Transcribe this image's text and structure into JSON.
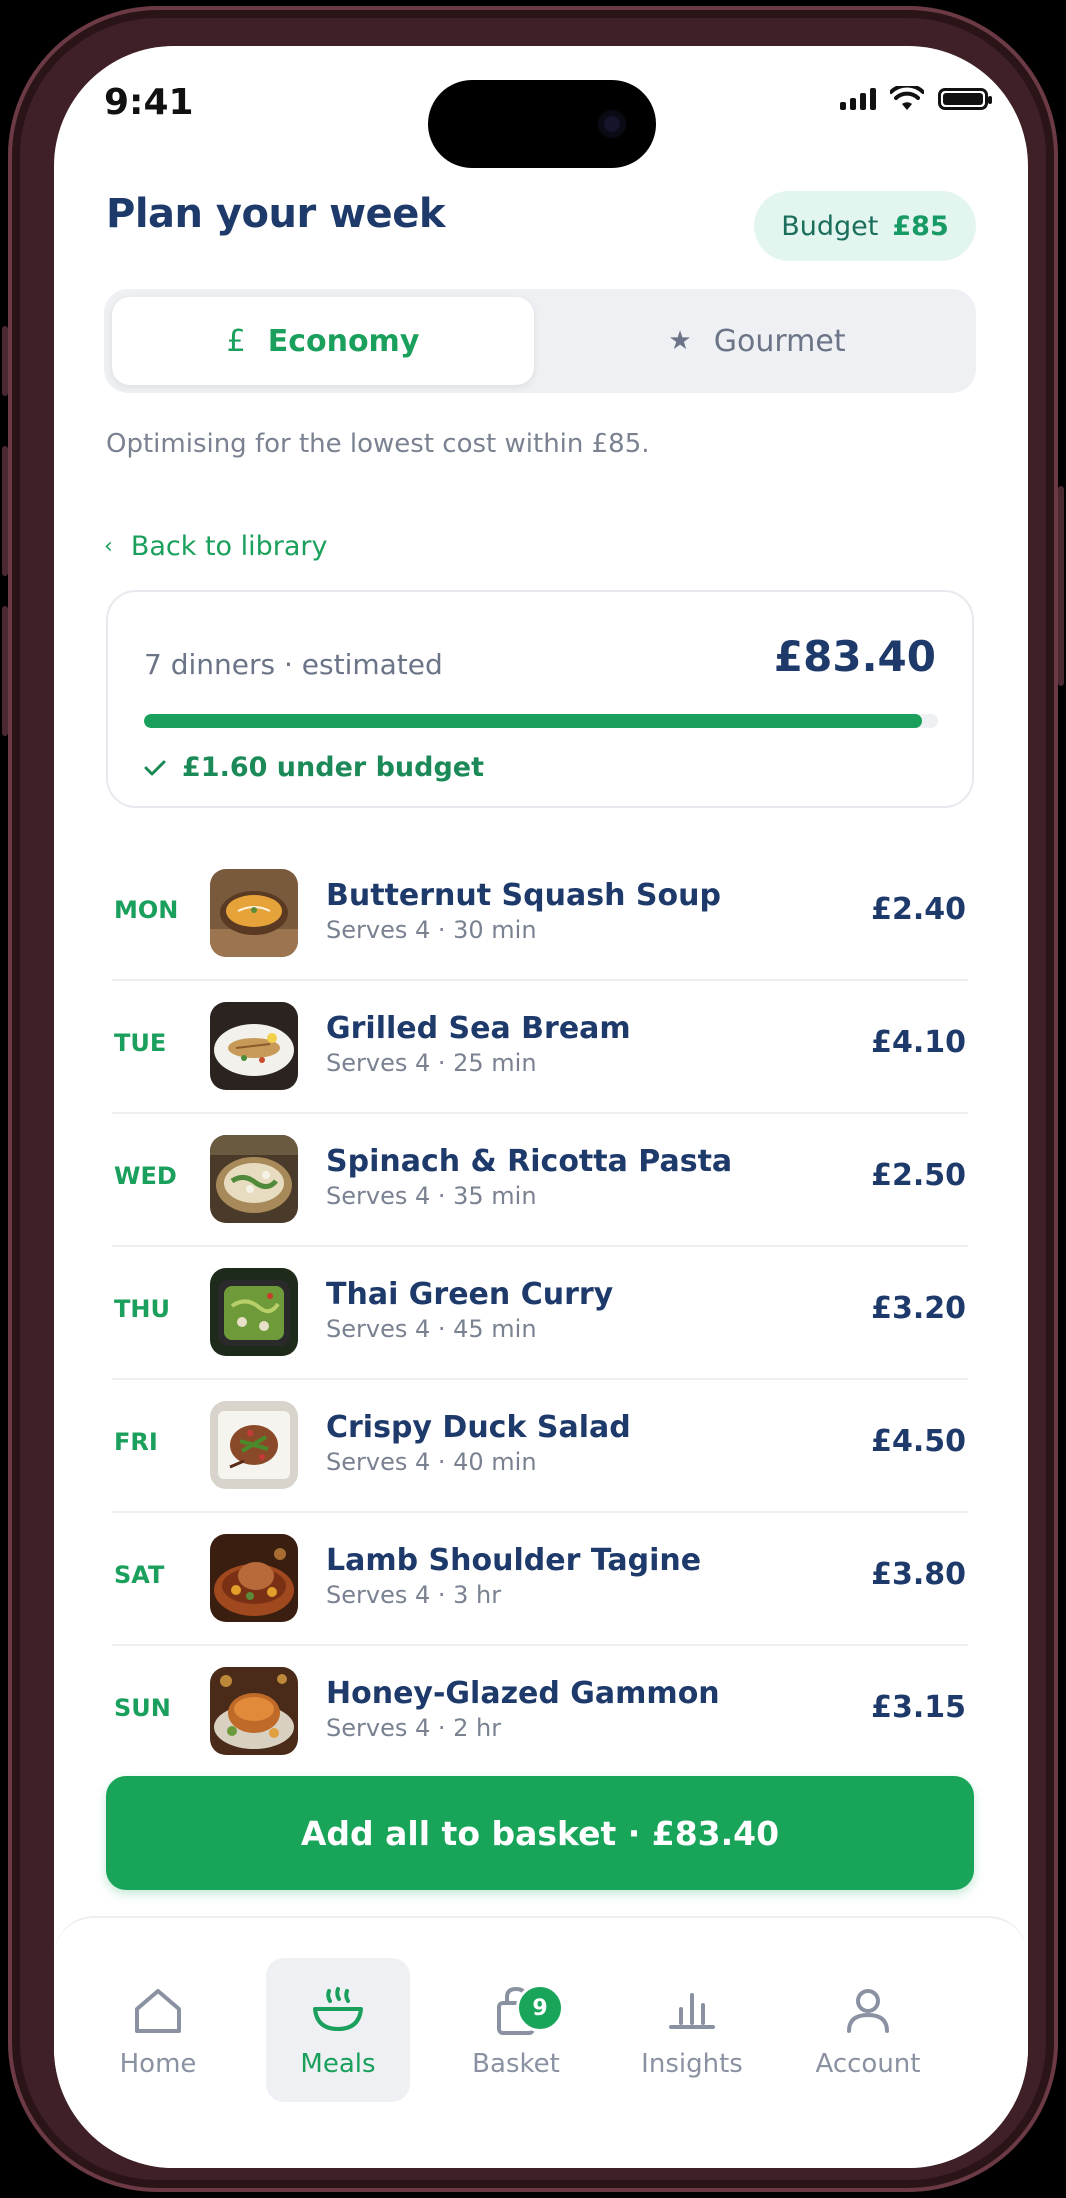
{
  "status_bar": {
    "time": "9:41"
  },
  "header": {
    "title": "Plan your week",
    "budget_label": "Budget",
    "budget_value": "£85"
  },
  "mode_toggle": {
    "options": [
      {
        "label": "Economy",
        "icon": "pound-icon",
        "active": true
      },
      {
        "label": "Gourmet",
        "icon": "star-icon",
        "active": false
      }
    ]
  },
  "subtitle": "Optimising for the lowest cost within £85.",
  "back_link": "Back to library",
  "summary": {
    "label": "7 dinners · estimated",
    "total": "£83.40",
    "progress_fraction": 0.98,
    "under_budget": "£1.60 under budget"
  },
  "meals": [
    {
      "day": "MON",
      "name": "Butternut Squash Soup",
      "meta": "Serves 4 · 30 min",
      "price": "£2.40"
    },
    {
      "day": "TUE",
      "name": "Grilled Sea Bream",
      "meta": "Serves 4 · 25 min",
      "price": "£4.10"
    },
    {
      "day": "WED",
      "name": "Spinach & Ricotta Pasta",
      "meta": "Serves 4 · 35 min",
      "price": "£2.50"
    },
    {
      "day": "THU",
      "name": "Thai Green Curry",
      "meta": "Serves 4 · 45 min",
      "price": "£3.20"
    },
    {
      "day": "FRI",
      "name": "Crispy Duck Salad",
      "meta": "Serves 4 · 40 min",
      "price": "£4.50"
    },
    {
      "day": "SAT",
      "name": "Lamb Shoulder Tagine",
      "meta": "Serves 4 · 3 hr",
      "price": "£3.80"
    },
    {
      "day": "SUN",
      "name": "Honey-Glazed Gammon",
      "meta": "Serves 4 · 2 hr",
      "price": "£3.15"
    }
  ],
  "cta": "Add all to basket · £83.40",
  "tabs": [
    {
      "label": "Home",
      "icon": "home-icon"
    },
    {
      "label": "Meals",
      "icon": "bowl-icon",
      "active": true
    },
    {
      "label": "Basket",
      "icon": "bag-icon",
      "badge": "9"
    },
    {
      "label": "Insights",
      "icon": "bar-chart-icon"
    },
    {
      "label": "Account",
      "icon": "person-icon"
    }
  ],
  "colors": {
    "accent": "#1aa05c",
    "navy": "#1e3a6b",
    "muted": "#7a8291",
    "pill_bg": "#e3f5ef"
  }
}
